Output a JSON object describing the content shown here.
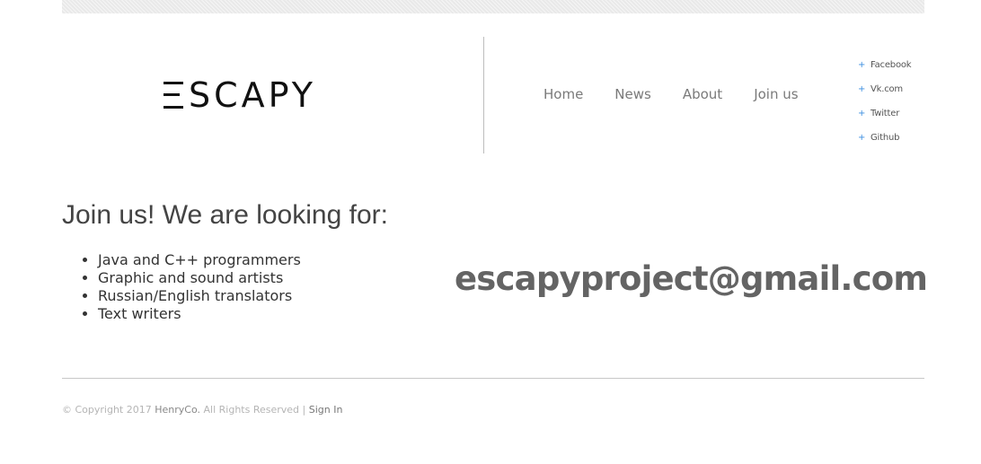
{
  "header": {
    "logo_text": "SCAPY",
    "nav": [
      "Home",
      "News",
      "About",
      "Join us"
    ],
    "social": [
      "Facebook",
      "Vk.com",
      "Twitter",
      "Github"
    ],
    "social_bullet": "+"
  },
  "main": {
    "heading": "Join us! We are looking for:",
    "roles": [
      "Java and C++ programmers",
      "Graphic and sound artists",
      "Russian/English translators",
      "Text writers"
    ],
    "email": "escapyproject@gmail.com"
  },
  "footer": {
    "copyright": "© Copyright 2017",
    "brand": "HenryCo.",
    "rights": "All Rights Reserved |",
    "sign_in": "Sign In"
  },
  "colors": {
    "accent": "#3b8ee0",
    "nav_text": "#7a7a7a",
    "email_text": "#646464"
  }
}
